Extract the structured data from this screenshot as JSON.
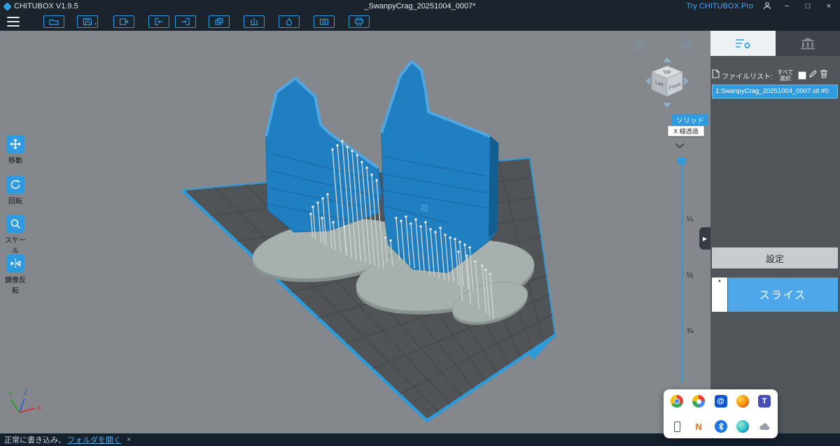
{
  "theme": {
    "accent": "#2E9AE0",
    "model_blue": "#1F7FC0",
    "panel_gray": "#51565B",
    "titlebar": "#1B242C"
  },
  "title_bar": {
    "app_name": "CHITUBOX V1.9.5",
    "document_title": "_SwanpyCrag_20251004_0007*",
    "try_pro_label": "Try CHITUBOX Pro",
    "minimize_glyph": "−",
    "maximize_glyph": "□",
    "close_glyph": "×"
  },
  "toolbar": {
    "icons": [
      "open-file",
      "save-file",
      "export-file",
      "import-model",
      "export-model",
      "clone-model",
      "edit-support",
      "hollow-model",
      "dig-hole",
      "print-slice"
    ]
  },
  "left_tools": {
    "items": [
      {
        "id": "move",
        "label": "移動"
      },
      {
        "id": "rotate",
        "label": "回転"
      },
      {
        "id": "scale",
        "label": "スケール"
      },
      {
        "id": "mirror",
        "label": "鏡像反転"
      }
    ]
  },
  "viewport": {
    "view_cube": {
      "top": "Top",
      "left": "Left",
      "front": "Front"
    },
    "render_mode_tag": "ソリッド",
    "render_mode_option": "X 線透過",
    "slider_labels": [
      "¼",
      "½",
      "¾"
    ],
    "axes": {
      "x": "X",
      "y": "Y",
      "z": "Z"
    }
  },
  "right_panel": {
    "file_list_label": "ファイルリスト:",
    "select_all_label": "すべて選択",
    "files": [
      {
        "name": "1:SwanpyCrag_20251004_0007.stl #0",
        "selected": true
      }
    ],
    "settings_button": "設定",
    "slice_button": "スライス",
    "slice_expand_glyph": "▲"
  },
  "status_bar": {
    "message": "正常に書き込み、",
    "open_folder_link": "フォルダを開く",
    "close_glyph": "×"
  },
  "tray_popup": {
    "icons": [
      "chrome",
      "google",
      "mail-at",
      "firefox",
      "teams",
      "phone",
      "onenote-n",
      "bluetooth",
      "edge",
      "cloud"
    ]
  }
}
